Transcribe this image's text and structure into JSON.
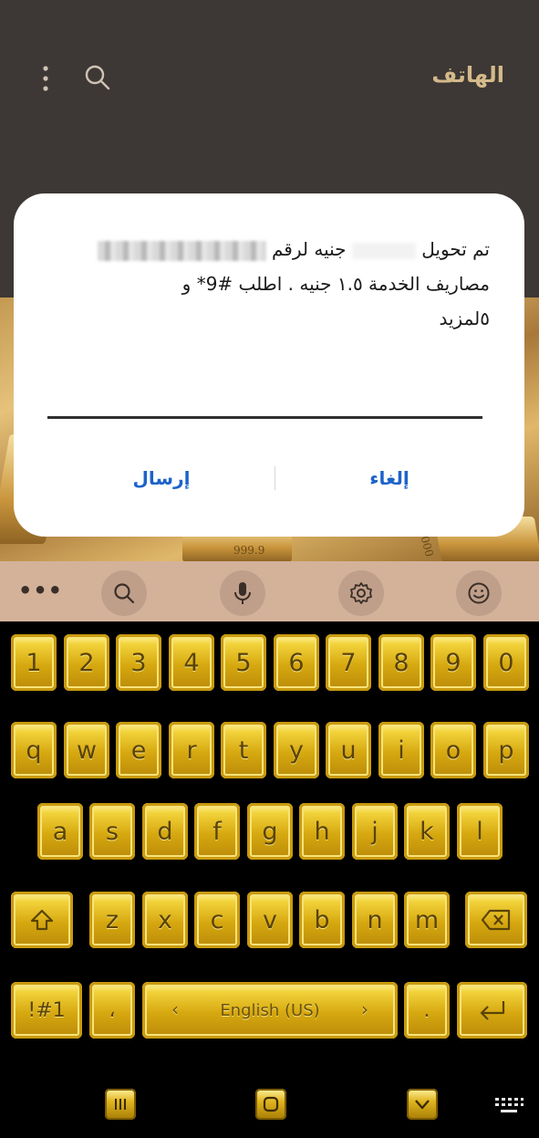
{
  "app": {
    "title": "الهاتف"
  },
  "dialog": {
    "line1_start": "تم تحويل",
    "line1_mid": "جنيه لرقم",
    "line2": "مصاريف الخدمة ١.٥ جنيه . اطلب #9* و",
    "line3": "٥لمزيد",
    "confirm_label": "إرسال",
    "cancel_label": "إلغاء"
  },
  "background": {
    "bar_label_1": "999.9",
    "bar_label_2": "1000"
  },
  "keyboard": {
    "toolbar": {
      "more": "•••"
    },
    "row_numbers": [
      "1",
      "2",
      "3",
      "4",
      "5",
      "6",
      "7",
      "8",
      "9",
      "0"
    ],
    "row_top": [
      "q",
      "w",
      "e",
      "r",
      "t",
      "y",
      "u",
      "i",
      "o",
      "p"
    ],
    "row_mid": [
      "a",
      "s",
      "d",
      "f",
      "g",
      "h",
      "j",
      "k",
      "l"
    ],
    "row_bottom": [
      "z",
      "x",
      "c",
      "v",
      "b",
      "n",
      "m"
    ],
    "symbols_label": "!#1",
    "comma_label": "،",
    "space_label": "English (US)",
    "period_label": "."
  },
  "colors": {
    "dialog_button": "#1d63c9",
    "app_bar": "#3d3835",
    "key_gold": "#d6a810",
    "toolbar": "#d4b29a"
  }
}
